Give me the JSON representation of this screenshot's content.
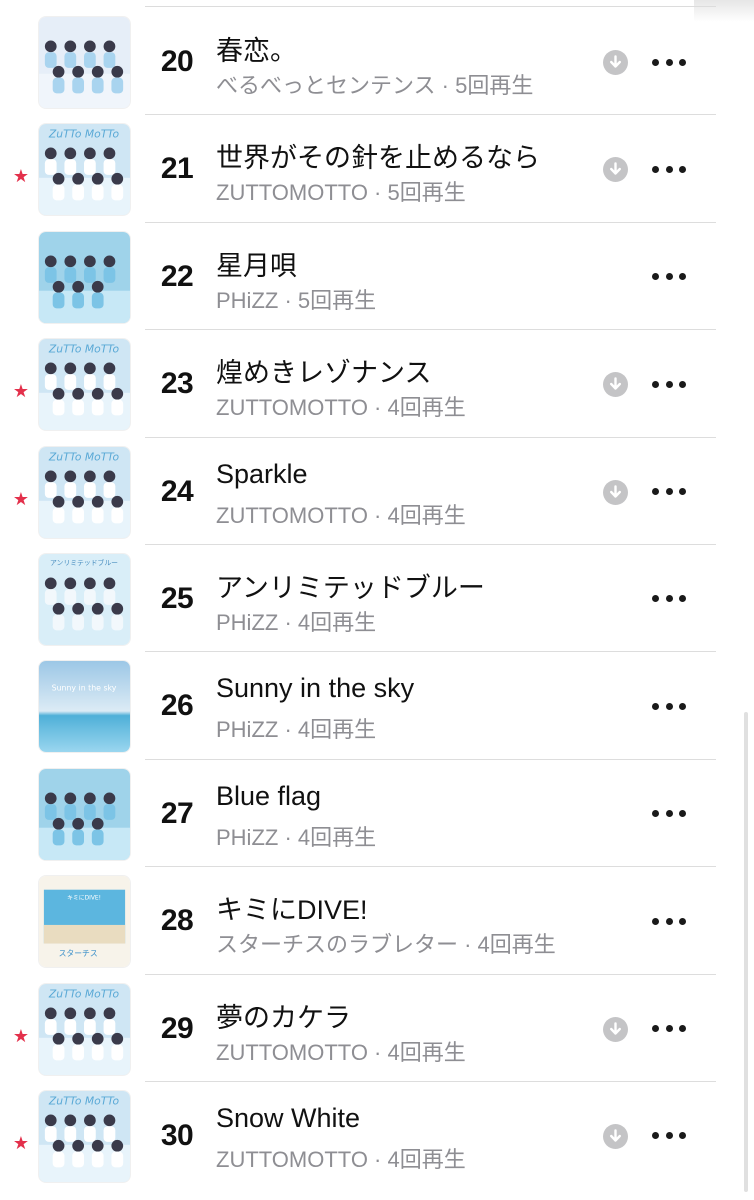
{
  "tracks": [
    {
      "rank": "20",
      "title": "春恋。",
      "meta": "べるべっとセンテンス · 5回再生",
      "starred": false,
      "downloadable": true,
      "art": "a"
    },
    {
      "rank": "21",
      "title": "世界がその針を止めるなら",
      "meta": "ZUTTOMOTTO · 5回再生",
      "starred": true,
      "downloadable": true,
      "art": "z"
    },
    {
      "rank": "22",
      "title": "星月唄",
      "meta": "PHiZZ · 5回再生",
      "starred": false,
      "downloadable": false,
      "art": "p"
    },
    {
      "rank": "23",
      "title": "煌めきレゾナンス",
      "meta": "ZUTTOMOTTO · 4回再生",
      "starred": true,
      "downloadable": true,
      "art": "z"
    },
    {
      "rank": "24",
      "title": "Sparkle",
      "meta": "ZUTTOMOTTO · 4回再生",
      "starred": true,
      "downloadable": true,
      "art": "z"
    },
    {
      "rank": "25",
      "title": "アンリミテッドブルー",
      "meta": "PHiZZ · 4回再生",
      "starred": false,
      "downloadable": false,
      "art": "u"
    },
    {
      "rank": "26",
      "title": "Sunny in the sky",
      "meta": "PHiZZ · 4回再生",
      "starred": false,
      "downloadable": false,
      "art": "s"
    },
    {
      "rank": "27",
      "title": "Blue flag",
      "meta": "PHiZZ · 4回再生",
      "starred": false,
      "downloadable": false,
      "art": "p"
    },
    {
      "rank": "28",
      "title": "キミにDIVE!",
      "meta": "スターチスのラブレター · 4回再生",
      "starred": false,
      "downloadable": false,
      "art": "b"
    },
    {
      "rank": "29",
      "title": "夢のカケラ",
      "meta": "ZUTTOMOTTO · 4回再生",
      "starred": true,
      "downloadable": true,
      "art": "z"
    },
    {
      "rank": "30",
      "title": "Snow White",
      "meta": "ZUTTOMOTTO · 4回再生",
      "starred": true,
      "downloadable": true,
      "art": "z"
    }
  ],
  "icons": {
    "star": "★",
    "download": "download-icon",
    "more": "more-options-icon"
  },
  "colors": {
    "star": "#e3304b",
    "secondary_text": "#8e8e93",
    "download_circle": "#c4c4c6"
  }
}
